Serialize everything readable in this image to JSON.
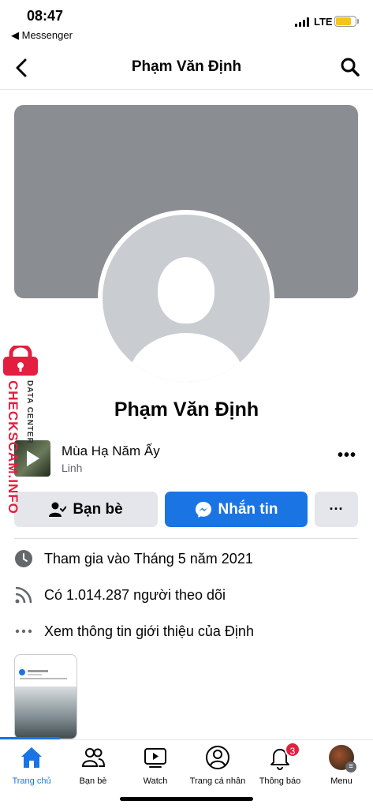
{
  "status_bar": {
    "time": "08:47",
    "back_app": "◀ Messenger",
    "network": "LTE",
    "battery_color": "#f5c518"
  },
  "header": {
    "title": "Phạm Văn Định",
    "back_icon": "chevron-left-icon",
    "search_icon": "search-icon"
  },
  "profile": {
    "name": "Phạm Văn Định",
    "music": {
      "title": "Mùa Hạ Năm Ấy",
      "artist": "Linh"
    }
  },
  "actions": {
    "friends_label": "Bạn bè",
    "message_label": "Nhắn tin",
    "more_label": "···"
  },
  "intro": {
    "joined": "Tham gia vào Tháng 5 năm 2021",
    "followers": "Có 1.014.287 người theo dõi",
    "about": "Xem thông tin giới thiệu của Định"
  },
  "watermark": {
    "main": "CHECKSCAM.INFO",
    "sub": "DATA CENTER"
  },
  "tabbar": {
    "items": [
      {
        "label": "Trang chủ",
        "icon": "home-icon",
        "active": true
      },
      {
        "label": "Bạn bè",
        "icon": "friends-icon"
      },
      {
        "label": "Watch",
        "icon": "watch-icon"
      },
      {
        "label": "Trang cá nhân",
        "icon": "profile-icon"
      },
      {
        "label": "Thông báo",
        "icon": "bell-icon",
        "badge": "3"
      },
      {
        "label": "Menu",
        "icon": "menu-avatar-icon"
      }
    ]
  },
  "colors": {
    "accent": "#1b74e4",
    "badge": "#e41e3f",
    "cover": "#8a8d91"
  }
}
